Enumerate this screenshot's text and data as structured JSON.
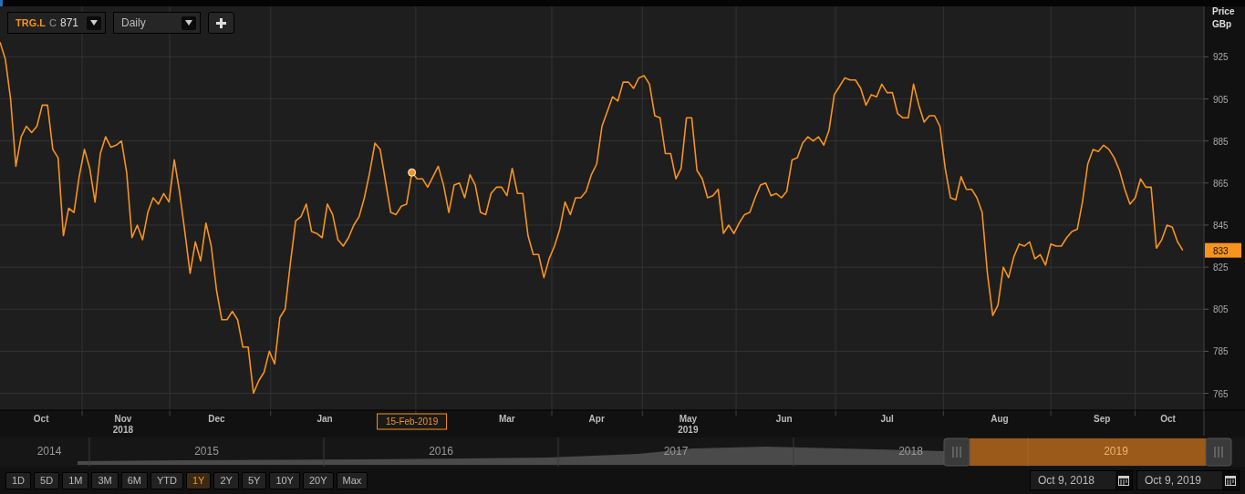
{
  "toolbar": {
    "symbol": {
      "ticker": "TRG.L",
      "close_label": "C",
      "close_value": "871"
    },
    "interval": "Daily"
  },
  "chart": {
    "y_axis_title": [
      "Price",
      "GBp"
    ],
    "last_price": "833",
    "crosshair": {
      "label": "15-Feb-2019"
    },
    "x_axis_labels": [
      "Oct",
      "Nov",
      "Dec",
      "Jan",
      "Mar",
      "Apr",
      "May",
      "Jun",
      "Jul",
      "Aug",
      "Sep",
      "Oct"
    ],
    "year_labels": [
      "2018",
      "2019"
    ],
    "chart_data": {
      "type": "line",
      "ylim": [
        757,
        949
      ],
      "grid": true,
      "yticks": [
        765,
        785,
        805,
        825,
        845,
        865,
        885,
        905,
        925
      ],
      "series": [
        {
          "color": "#f7931e",
          "values": [
            932,
            924,
            905,
            873,
            887,
            892,
            889,
            892,
            902,
            902,
            881,
            877,
            840,
            853,
            851,
            868,
            881,
            872,
            856,
            879,
            887,
            882,
            883,
            885,
            870,
            839,
            845,
            838,
            851,
            858,
            855,
            860,
            856,
            876,
            861,
            842,
            822,
            837,
            828,
            846,
            835,
            814,
            800,
            800,
            804,
            800,
            787,
            787,
            765,
            771,
            775,
            785,
            779,
            801,
            805,
            827,
            847,
            849,
            855,
            842,
            841,
            839,
            855,
            850,
            838,
            835,
            839,
            845,
            849,
            858,
            870,
            884,
            881,
            866,
            851,
            850,
            854,
            855,
            870,
            867,
            867,
            863,
            868,
            873,
            864,
            851,
            864,
            865,
            858,
            869,
            864,
            851,
            850,
            860,
            863,
            863,
            859,
            872,
            860,
            860,
            840,
            831,
            831,
            820,
            829,
            835,
            843,
            856,
            850,
            858,
            858,
            861,
            869,
            874,
            892,
            899,
            906,
            904,
            913,
            913,
            910,
            915,
            916,
            912,
            897,
            896,
            879,
            879,
            867,
            872,
            896,
            896,
            871,
            867,
            858,
            859,
            862,
            841,
            845,
            841,
            846,
            850,
            851,
            858,
            864,
            865,
            859,
            860,
            858,
            861,
            876,
            877,
            884,
            887,
            885,
            887,
            883,
            890,
            907,
            911,
            915,
            914,
            914,
            910,
            902,
            907,
            906,
            912,
            908,
            908,
            898,
            896,
            896,
            912,
            902,
            894,
            897,
            897,
            892,
            872,
            858,
            857,
            868,
            862,
            862,
            858,
            851,
            822,
            802,
            807,
            825,
            820,
            830,
            836,
            835,
            837,
            829,
            831,
            826,
            836,
            835,
            835,
            839,
            842,
            843,
            856,
            874,
            881,
            880,
            883,
            881,
            877,
            871,
            862,
            855,
            858,
            867,
            863,
            863,
            834,
            838,
            845,
            844,
            837,
            833
          ]
        }
      ]
    }
  },
  "navigator": {
    "years": [
      {
        "label": "2014",
        "selected": false
      },
      {
        "label": "2015",
        "selected": false
      },
      {
        "label": "2016",
        "selected": false
      },
      {
        "label": "2017",
        "selected": false
      },
      {
        "label": "2018",
        "selected": false
      },
      {
        "label": "2019",
        "selected": true
      }
    ]
  },
  "range_buttons": [
    {
      "label": "1D",
      "selected": false
    },
    {
      "label": "5D",
      "selected": false
    },
    {
      "label": "1M",
      "selected": false
    },
    {
      "label": "3M",
      "selected": false
    },
    {
      "label": "6M",
      "selected": false
    },
    {
      "label": "YTD",
      "selected": false
    },
    {
      "label": "1Y",
      "selected": true
    },
    {
      "label": "2Y",
      "selected": false
    },
    {
      "label": "5Y",
      "selected": false
    },
    {
      "label": "10Y",
      "selected": false
    },
    {
      "label": "20Y",
      "selected": false
    },
    {
      "label": "Max",
      "selected": false
    }
  ],
  "date_range": {
    "from": "Oct 9, 2018",
    "to": "Oct 9, 2019"
  }
}
